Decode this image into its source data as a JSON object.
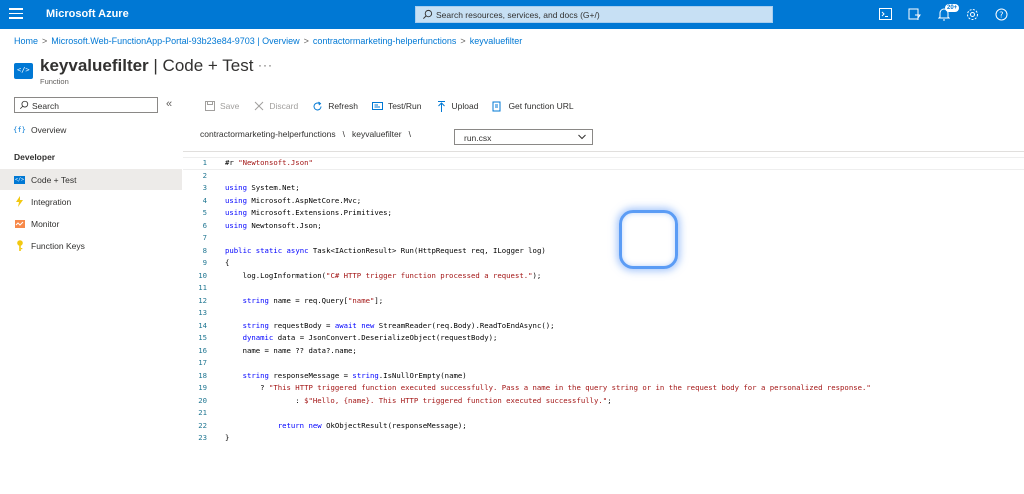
{
  "topbar": {
    "brand": "Microsoft Azure",
    "search_placeholder": "Search resources, services, and docs (G+/)",
    "notifications_badge": "20+",
    "icons": [
      "cloud-shell-icon",
      "directory-filter-icon",
      "notifications-icon",
      "settings-icon",
      "help-icon"
    ],
    "color": "#0078d4"
  },
  "breadcrumb": {
    "items": [
      "Home",
      "Microsoft.Web-FunctionApp-Portal-93b23e84-9703 | Overview",
      "contractormarketing-helperfunctions",
      "keyvaluefilter"
    ],
    "separator": ">"
  },
  "header": {
    "title_bold": "keyvaluefilter",
    "title_rest": " | Code + Test",
    "more": "···",
    "subtitle": "Function"
  },
  "sidebar": {
    "search_placeholder": "Search",
    "collapse": "«",
    "overview": "Overview",
    "section": "Developer",
    "items": [
      {
        "label": "Code + Test",
        "icon": "code-icon"
      },
      {
        "label": "Integration",
        "icon": "lightning-icon"
      },
      {
        "label": "Monitor",
        "icon": "monitor-icon"
      },
      {
        "label": "Function Keys",
        "icon": "key-icon"
      }
    ]
  },
  "toolbar": {
    "save": "Save",
    "discard": "Discard",
    "refresh": "Refresh",
    "test_run": "Test/Run",
    "upload": "Upload",
    "get_url": "Get function URL"
  },
  "path": {
    "app": "contractormarketing-helperfunctions",
    "function": "keyvaluefilter",
    "separator": "\\",
    "file": "run.csx"
  },
  "editor": {
    "lines": [
      "#r \"Newtonsoft.Json\"",
      "",
      "using System.Net;",
      "using Microsoft.AspNetCore.Mvc;",
      "using Microsoft.Extensions.Primitives;",
      "using Newtonsoft.Json;",
      "",
      "public static async Task<IActionResult> Run(HttpRequest req, ILogger log)",
      "{",
      "    log.LogInformation(\"C# HTTP trigger function processed a request.\");",
      "",
      "    string name = req.Query[\"name\"];",
      "",
      "    string requestBody = await new StreamReader(req.Body).ReadToEndAsync();",
      "    dynamic data = JsonConvert.DeserializeObject(requestBody);",
      "    name = name ?? data?.name;",
      "",
      "    string responseMessage = string.IsNullOrEmpty(name)",
      "        ? \"This HTTP triggered function executed successfully. Pass a name in the query string or in the request body for a personalized response.\"",
      "                : $\"Hello, {name}. This HTTP triggered function executed successfully.\";",
      "",
      "            return new OkObjectResult(responseMessage);",
      "}"
    ]
  }
}
